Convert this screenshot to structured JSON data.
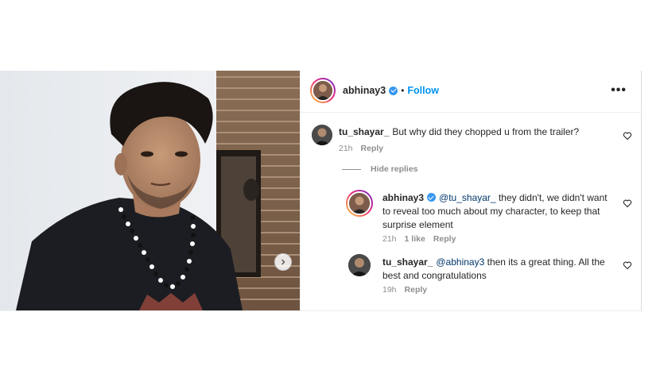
{
  "post": {
    "author": {
      "username": "abhinay3",
      "verified": true,
      "follow_label": "Follow",
      "separator": "•"
    },
    "more_label": "•••",
    "media": {
      "has_next": true
    }
  },
  "comments": [
    {
      "username": "tu_shayar_",
      "text": "But why did they chopped u from the trailer?",
      "time": "21h",
      "reply_label": "Reply",
      "hide_replies_label": "Hide replies",
      "replies": [
        {
          "username": "abhinay3",
          "verified": true,
          "mention": "@tu_shayar_",
          "text": "they didn't, we didn't want to reveal too much about my character, to keep that surprise element",
          "time": "21h",
          "likes": "1 like",
          "reply_label": "Reply"
        },
        {
          "username": "tu_shayar_",
          "mention": "@abhinay3",
          "text": "then its a great thing. All the best and congratulations",
          "time": "19h",
          "reply_label": "Reply"
        }
      ]
    }
  ],
  "colors": {
    "accent": "#0095f6",
    "verified": "#3897f0",
    "muted": "#8e8e8e",
    "text": "#262626"
  }
}
